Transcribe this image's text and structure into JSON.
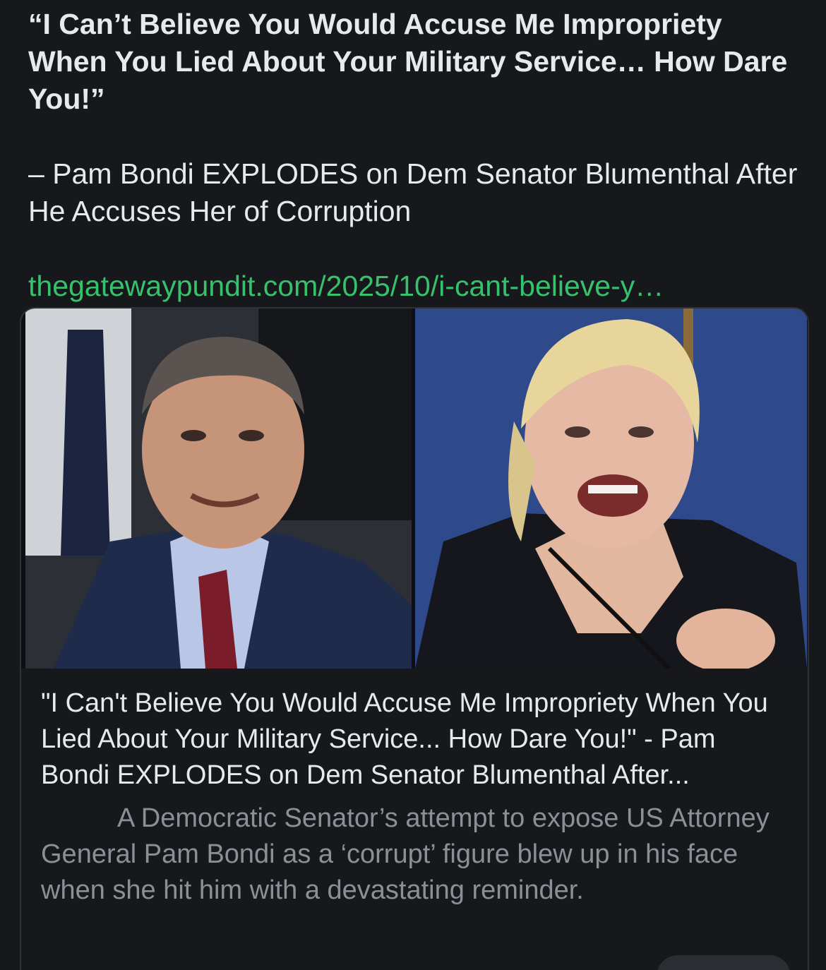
{
  "post": {
    "headline": "“I Can’t Believe You Would Accuse Me Impropriety When You Lied About Your Military Service… How Dare You!”",
    "subline": "– Pam Bondi EXPLODES on Dem Senator Blumenthal After He Accuses Her of Corruption",
    "link_text": "thegatewaypundit.com/2025/10/i-cant-believe-y…"
  },
  "link_card": {
    "title": "\"I Can't Believe You Would Accuse Me Impropriety When You Lied About Your Military Service... How Dare You!\" - Pam Bondi EXPLODES on Dem Senator Blumenthal After...",
    "description": "A Democratic Senator’s attempt to expose US Attorney General Pam Bondi as a ‘corrupt’ figure blew up in his face when she hit him with a devastating reminder."
  },
  "colors": {
    "background": "#16181c",
    "text": "#e7e9ea",
    "link": "#38c16c",
    "muted": "#8b9097",
    "card_border": "#2f3336"
  }
}
